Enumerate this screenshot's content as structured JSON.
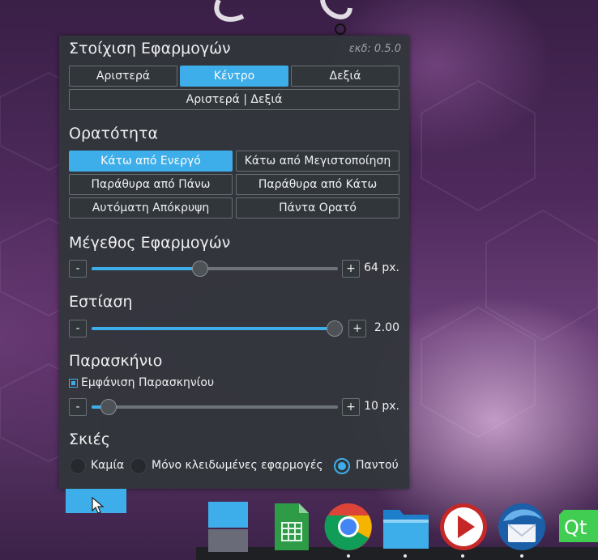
{
  "header": {
    "title": "Στοίχιση Εφαρμογών",
    "version": "εκδ: 0.5.0"
  },
  "alignment": {
    "buttons": [
      {
        "label": "Αριστερά",
        "active": false
      },
      {
        "label": "Κέντρο",
        "active": true
      },
      {
        "label": "Δεξιά",
        "active": false
      }
    ],
    "justify": {
      "label": "Αριστερά | Δεξιά",
      "active": false
    }
  },
  "visibility": {
    "title": "Ορατότητα",
    "buttons": [
      {
        "label": "Κάτω από Ενεργό",
        "active": true
      },
      {
        "label": "Κάτω από Μεγιστοποίηση",
        "active": false
      },
      {
        "label": "Παράθυρα από Πάνω",
        "active": false
      },
      {
        "label": "Παράθυρα από Κάτω",
        "active": false
      },
      {
        "label": "Αυτόματη Απόκρυψη",
        "active": false
      },
      {
        "label": "Πάντα Ορατό",
        "active": false
      }
    ]
  },
  "icon_size": {
    "title": "Μέγεθος Εφαρμογών",
    "value_label": "64 px.",
    "level": 0.44,
    "minus": "-",
    "plus": "+"
  },
  "zoom": {
    "title": "Εστίαση",
    "value_label": "2.00",
    "level": 1.0,
    "minus": "-",
    "plus": "+"
  },
  "background": {
    "title": "Παρασκήνιο",
    "show_label": "Εμφάνιση Παρασκηνίου",
    "show_checked": true,
    "value_label": "10 px.",
    "level": 0.07,
    "minus": "-",
    "plus": "+"
  },
  "shadows": {
    "title": "Σκιές",
    "options": [
      {
        "label": "Καμία",
        "selected": false
      },
      {
        "label": "Μόνο κλειδωμένες εφαρμογές",
        "selected": false
      },
      {
        "label": "Παντού",
        "selected": true
      }
    ]
  },
  "dock": {
    "icons": [
      "window-list-icon",
      "spreadsheet-icon",
      "chrome-icon",
      "folder-icon",
      "media-player-icon",
      "thunderbird-icon",
      "qt-icon"
    ],
    "qt_text": "Qt",
    "accent": "#3daee9"
  },
  "colors": {
    "accent": "#3daee9",
    "panel": "#31363b",
    "text": "#eff0f1"
  }
}
